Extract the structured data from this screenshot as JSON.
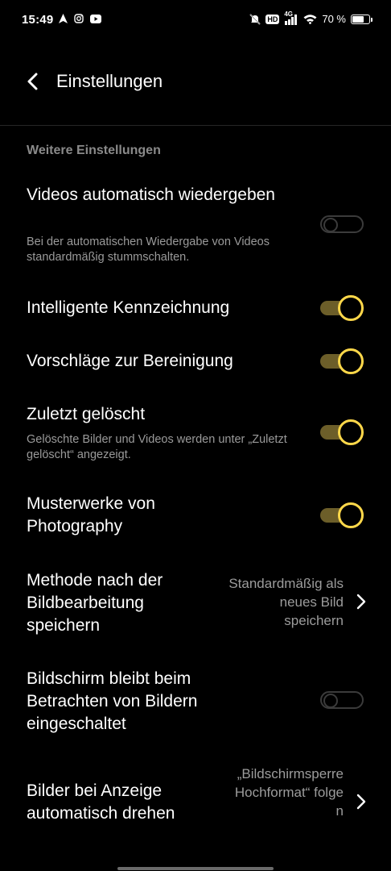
{
  "status_bar": {
    "time": "15:49",
    "battery": "70 %",
    "battery_level": 0.7,
    "network": "4G",
    "hd": "HD",
    "icons": [
      "navigation-icon",
      "instagram-icon",
      "youtube-icon",
      "mute-icon",
      "hd-icon",
      "signal-icon",
      "wifi-icon",
      "battery-icon"
    ]
  },
  "header": {
    "title": "Einstellungen",
    "back_icon": "chevron-left-icon"
  },
  "section": {
    "title": "Weitere Einstellungen"
  },
  "settings": [
    {
      "title": "Videos automatisch wiedergeben",
      "description": "Bei der automatischen Wiedergabe von Videos standardmäßig stummschalten.",
      "control": "toggle",
      "enabled": false
    },
    {
      "title": "Intelligente Kennzeichnung",
      "control": "toggle",
      "enabled": true
    },
    {
      "title": "Vorschläge zur Bereinigung",
      "control": "toggle",
      "enabled": true
    },
    {
      "title": "Zuletzt gelöscht",
      "description": "Gelöschte Bilder und Videos werden unter „Zuletzt gelöscht“ angezeigt.",
      "control": "toggle",
      "enabled": true
    },
    {
      "title": "Musterwerke von Photography",
      "control": "toggle",
      "enabled": true
    },
    {
      "title": "Methode nach der Bildbearbeitung speichern",
      "control": "select",
      "value": "Standardmäßig als neues Bild speichern"
    },
    {
      "title": "Bildschirm bleibt beim Betrachten von Bildern eingeschaltet",
      "control": "toggle",
      "enabled": false
    },
    {
      "title": "Bilder bei Anzeige automatisch drehen",
      "control": "select",
      "value": "„Bildschirmsperre Hochformat“ folgen"
    }
  ],
  "colors": {
    "background": "#000000",
    "accent": "#ffd84a",
    "accent_track": "#6c5e29",
    "secondary_text": "#9a9a9a"
  }
}
